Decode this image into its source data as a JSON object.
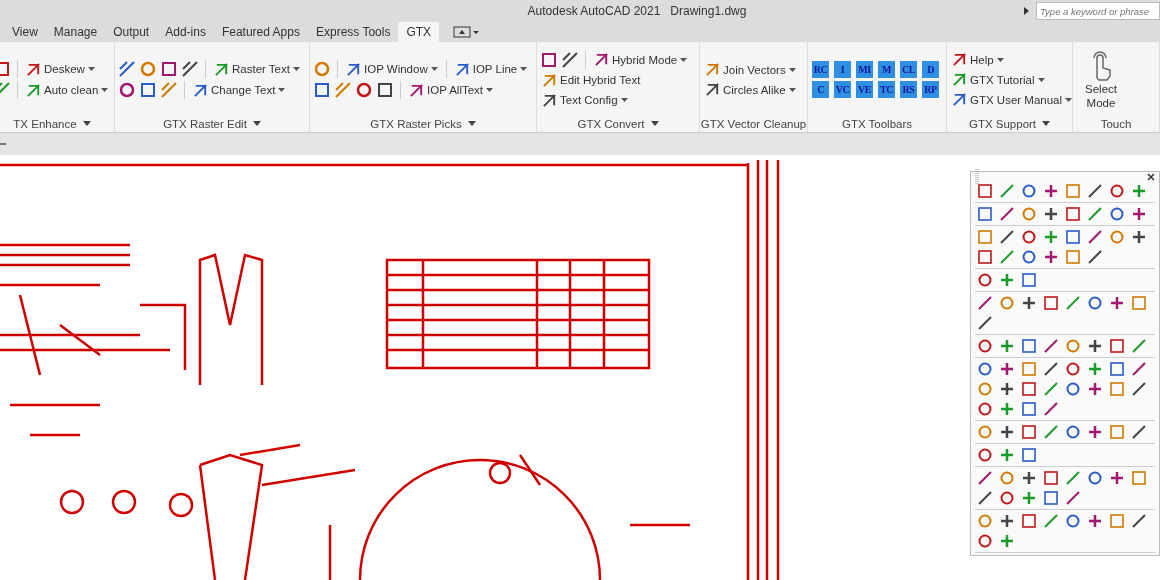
{
  "title_bar": {
    "app": "Autodesk AutoCAD 2021",
    "file": "Drawing1.dwg"
  },
  "search": {
    "placeholder": "Type a keyword or phrase"
  },
  "tabs": [
    {
      "label": "View",
      "selected": false
    },
    {
      "label": "Manage",
      "selected": false
    },
    {
      "label": "Output",
      "selected": false
    },
    {
      "label": "Add-ins",
      "selected": false
    },
    {
      "label": "Featured Apps",
      "selected": false
    },
    {
      "label": "Express Tools",
      "selected": false
    },
    {
      "label": "GTX",
      "selected": true
    }
  ],
  "panels": [
    {
      "title": "TX Enhance",
      "has_menu": true,
      "rows": [
        [
          {
            "kind": "icon"
          },
          {
            "kind": "sep"
          },
          {
            "kind": "button",
            "label": "Deskew",
            "dropdown": true
          }
        ],
        [
          {
            "kind": "icon"
          },
          {
            "kind": "sep"
          },
          {
            "kind": "button",
            "label": "Auto clean",
            "dropdown": true
          }
        ]
      ]
    },
    {
      "title": "GTX Raster Edit",
      "has_menu": true,
      "rows": [
        [
          {
            "kind": "icon"
          },
          {
            "kind": "icon"
          },
          {
            "kind": "icon"
          },
          {
            "kind": "icon"
          },
          {
            "kind": "sep"
          },
          {
            "kind": "button",
            "label": "Raster Text",
            "dropdown": true
          }
        ],
        [
          {
            "kind": "icon"
          },
          {
            "kind": "icon"
          },
          {
            "kind": "icon"
          },
          {
            "kind": "sep"
          },
          {
            "kind": "button",
            "label": "Change Text",
            "dropdown": true
          }
        ]
      ]
    },
    {
      "title": "GTX Raster Picks",
      "has_menu": true,
      "rows": [
        [
          {
            "kind": "icon"
          },
          {
            "kind": "sep"
          },
          {
            "kind": "button",
            "label": "IOP Window",
            "dropdown": true
          },
          {
            "kind": "sep"
          },
          {
            "kind": "button",
            "label": "IOP Line",
            "dropdown": true
          }
        ],
        [
          {
            "kind": "icon"
          },
          {
            "kind": "icon"
          },
          {
            "kind": "icon"
          },
          {
            "kind": "icon"
          },
          {
            "kind": "sep"
          },
          {
            "kind": "button",
            "label": "IOP AllText",
            "dropdown": true
          }
        ]
      ]
    },
    {
      "title": "GTX Convert",
      "has_menu": true,
      "rows": [
        [
          {
            "kind": "icon"
          },
          {
            "kind": "icon"
          },
          {
            "kind": "sep"
          },
          {
            "kind": "button",
            "label": "Hybrid Mode",
            "dropdown": true
          }
        ],
        [
          {
            "kind": "button",
            "label": "Edit Hybrid Text",
            "dropdown": false
          }
        ],
        [
          {
            "kind": "button",
            "label": "Text Config",
            "dropdown": true
          }
        ]
      ]
    },
    {
      "title": "GTX Vector Cleanup",
      "has_menu": false,
      "rows": [
        [
          {
            "kind": "button",
            "label": "Join Vectors",
            "dropdown": true
          }
        ],
        [
          {
            "kind": "button",
            "label": "Circles Alike",
            "dropdown": true
          }
        ]
      ]
    },
    {
      "title": "GTX Toolbars",
      "has_menu": false,
      "rows": [
        [
          {
            "kind": "tag",
            "label": "RC"
          },
          {
            "kind": "tag",
            "label": "I"
          },
          {
            "kind": "tag",
            "label": "MI"
          },
          {
            "kind": "tag",
            "label": "M"
          },
          {
            "kind": "tag",
            "label": "CL"
          },
          {
            "kind": "tag",
            "label": "D"
          }
        ],
        [
          {
            "kind": "tag",
            "label": "C"
          },
          {
            "kind": "tag",
            "label": "VC"
          },
          {
            "kind": "tag",
            "label": "VE"
          },
          {
            "kind": "tag",
            "label": "TC"
          },
          {
            "kind": "tag",
            "label": "RS"
          },
          {
            "kind": "tag",
            "label": "RP"
          }
        ]
      ]
    },
    {
      "title": "GTX Support",
      "has_menu": true,
      "rows": [
        [
          {
            "kind": "button",
            "label": "Help",
            "dropdown": true
          }
        ],
        [
          {
            "kind": "button",
            "label": "GTX Tutorial",
            "dropdown": true
          }
        ],
        [
          {
            "kind": "button",
            "label": "GTX User Manual",
            "dropdown": true
          }
        ]
      ]
    },
    {
      "title": "Touch",
      "has_menu": false,
      "rows": [
        [
          {
            "kind": "large",
            "label": "Select Mode"
          }
        ]
      ]
    }
  ]
}
